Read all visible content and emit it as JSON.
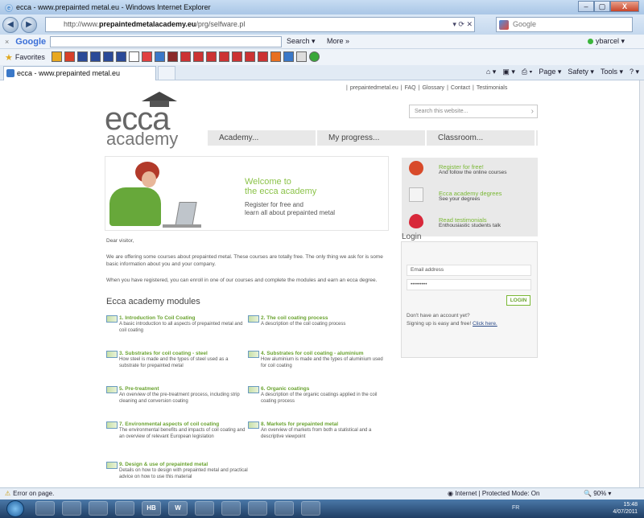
{
  "window": {
    "title": "ecca - www.prepainted metal.eu - Windows Internet Explorer",
    "min": "–",
    "max": "▢",
    "close": "X"
  },
  "address": {
    "prefix": "http://www.",
    "domain": "prepaintedmetalacademy.eu",
    "path": "/prg/selfware.pl",
    "search_placeholder": "Google"
  },
  "google_toolbar": {
    "close": "×",
    "logo": "Google",
    "search": "Search ▾",
    "more": "More »",
    "user": "ybarcel ▾"
  },
  "favorites": {
    "label": "Favorites"
  },
  "tab": {
    "label": "ecca - www.prepainted metal.eu"
  },
  "command_bar": {
    "page": "Page ▾",
    "safety": "Safety ▾",
    "tools": "Tools ▾"
  },
  "site": {
    "top_links": [
      "prepaintedmetal.eu",
      "FAQ",
      "Glossary",
      "Contact",
      "Testimonials"
    ],
    "search_placeholder": "Search this website...",
    "logo_ecca": "ecca",
    "logo_academy": "academy",
    "menu": [
      "Academy...",
      "My progress...",
      "Classroom..."
    ],
    "welcome_title_1": "Welcome to",
    "welcome_title_2": "the ecca academy",
    "welcome_sub_1": "Register for free and",
    "welcome_sub_2": "learn all about prepainted metal",
    "greeting": "Dear visitor,",
    "para1": "We are offering some courses about prepainted metal. These courses are totally free. The only thing we ask for is some basic information about you and your company.",
    "para2": "When you have registered, you can enroll in one of our courses and complete the modules and earn an ecca degree.",
    "modules_heading": "Ecca academy modules",
    "modules": [
      {
        "title": "1. Introduction To Coil Coating",
        "desc": "A basic introduction to all aspects of prepainted metal and coil coating"
      },
      {
        "title": "2. The coil coating process",
        "desc": "A description of the coil coating process"
      },
      {
        "title": "3. Substrates for coil coating - steel",
        "desc": "How steel is made and the types of steel used as a substrate for prepainted metal"
      },
      {
        "title": "4. Substrates for coil coating - aluminium",
        "desc": "How aluminium is made and the types of aluminium used for coil coating"
      },
      {
        "title": "5. Pre-treatment",
        "desc": "An overview of the pre-treatment process, including strip cleaning and conversion coating"
      },
      {
        "title": "6. Organic coatings",
        "desc": "A description of the organic coatings applied in the coil coating process"
      },
      {
        "title": "7. Environmental aspects of coil coating",
        "desc": "The environmental benefits and impacts of coil coating and an overview of relevant European legislation"
      },
      {
        "title": "8. Markets for prepainted metal",
        "desc": "An overview of markets from both a statistical and a descriptive viewpoint"
      },
      {
        "title": "9. Design & use of prepainted metal",
        "desc": "Details on how to design with prepainted metal and practical advice on how to use this material"
      }
    ],
    "side": [
      {
        "title": "Register for free!",
        "sub": "And follow the online courses"
      },
      {
        "title": "Ecca academy degrees",
        "sub": "See your degrees"
      },
      {
        "title": "Read testimonials",
        "sub": "Enthousiastic students talk"
      }
    ],
    "login": {
      "heading": "Login",
      "email_placeholder": "Email address",
      "password_value": "•••••••••",
      "button": "LOGIN",
      "note1": "Don't have an account yet?",
      "note2": "Signing up is easy and free!",
      "note2_link": "Click here."
    }
  },
  "status": {
    "error": "Error on page.",
    "zone": "Internet | Protected Mode: On",
    "zoom": "90%"
  },
  "taskbar": {
    "lang": "FR",
    "time": "15:48",
    "date": "4/07/2011",
    "icons": [
      "",
      "",
      "",
      "",
      "HB",
      "W",
      "",
      "",
      "",
      "",
      ""
    ]
  }
}
